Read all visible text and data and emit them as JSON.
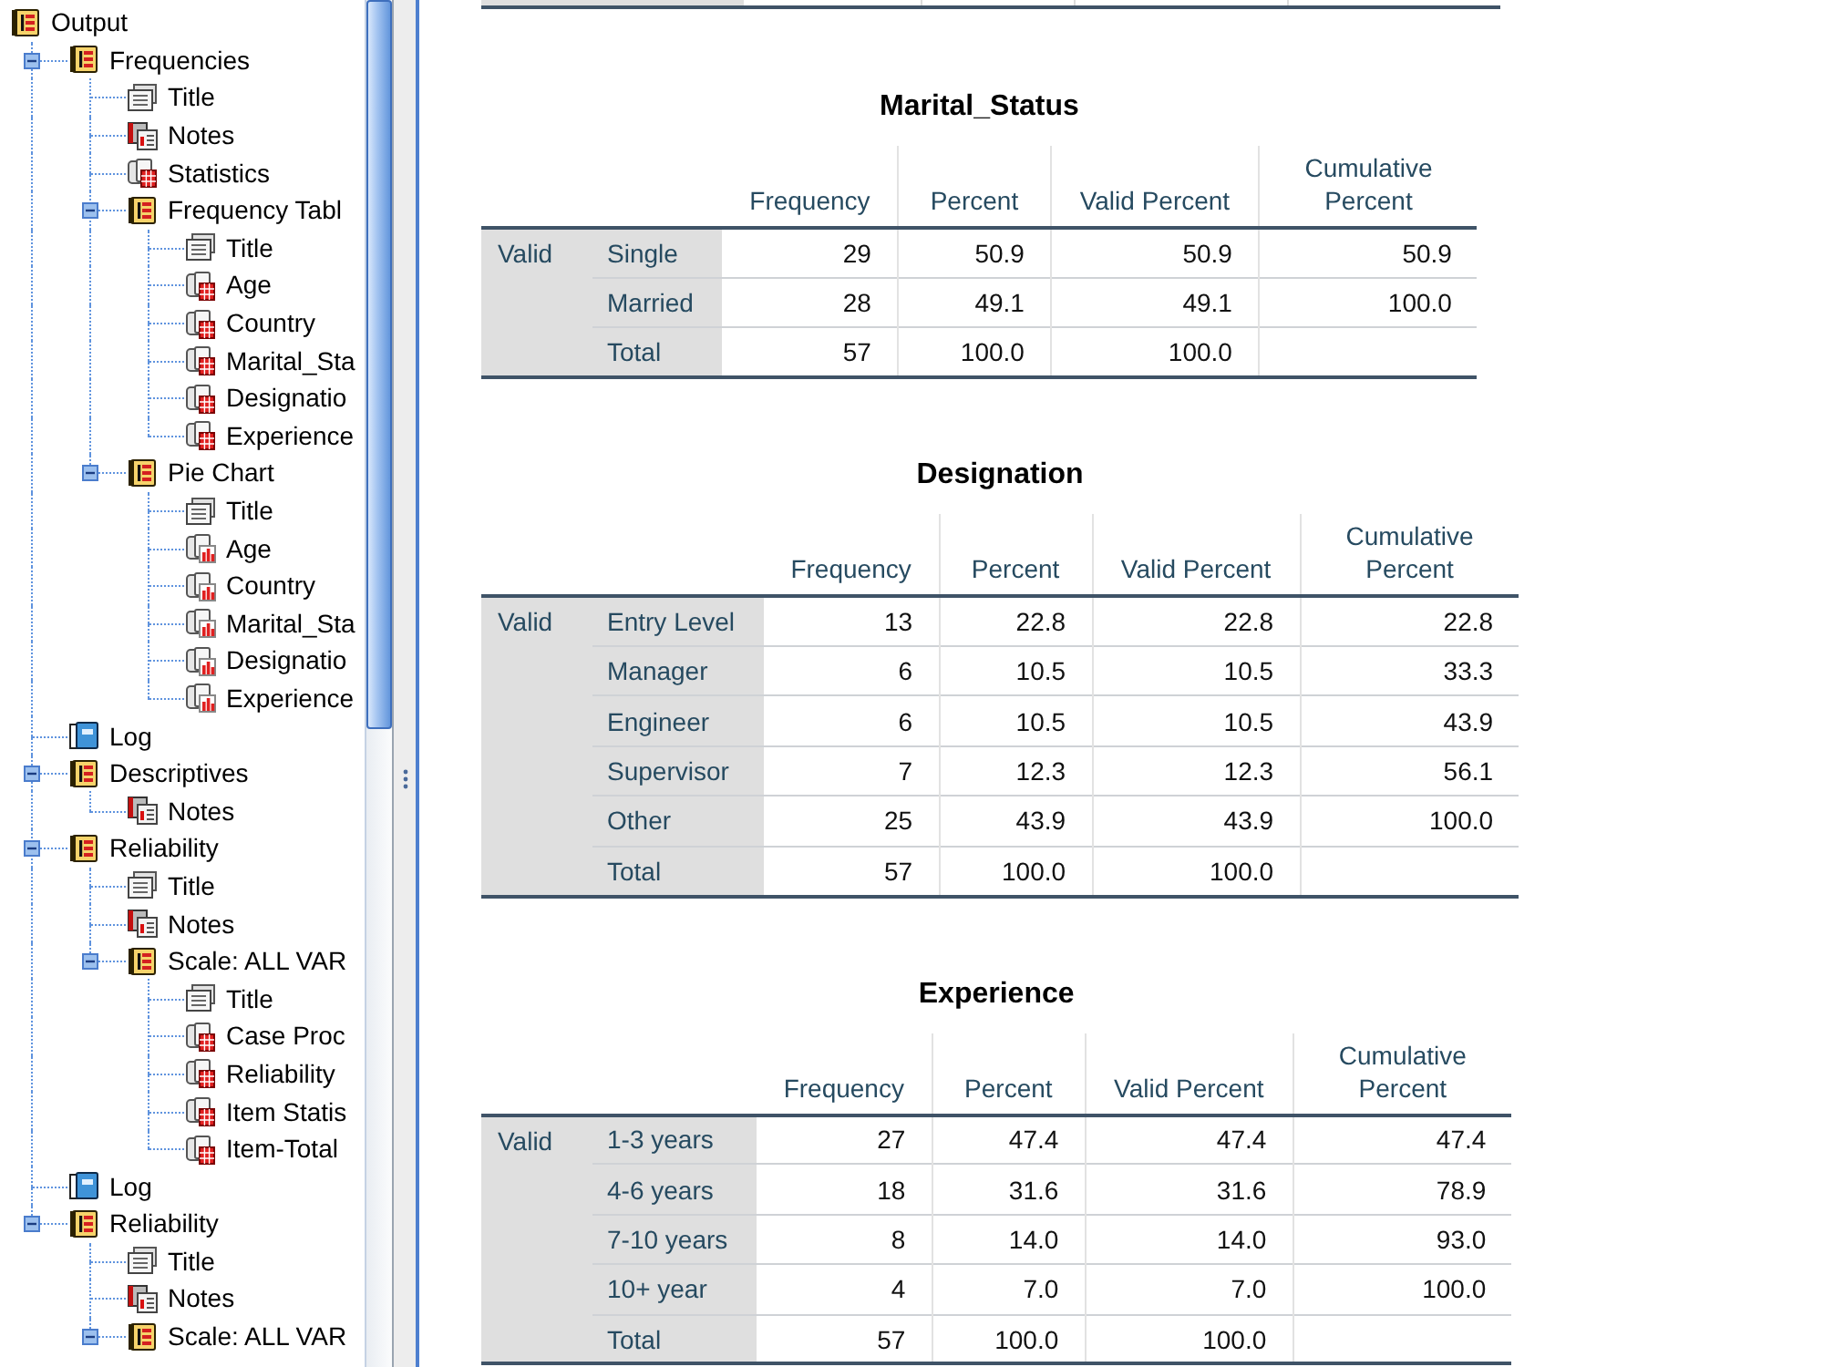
{
  "navigator": {
    "items": [
      {
        "label": "Output",
        "kind": "heading",
        "children": [
          {
            "label": "Frequencies",
            "kind": "heading",
            "expanded": true,
            "children": [
              {
                "label": "Title",
                "kind": "title"
              },
              {
                "label": "Notes",
                "kind": "notes"
              },
              {
                "label": "Statistics",
                "kind": "table"
              },
              {
                "label": "Frequency Tabl",
                "kind": "heading",
                "expanded": true,
                "children": [
                  {
                    "label": "Title",
                    "kind": "title"
                  },
                  {
                    "label": "Age",
                    "kind": "table"
                  },
                  {
                    "label": "Country",
                    "kind": "table"
                  },
                  {
                    "label": "Marital_Sta",
                    "kind": "table"
                  },
                  {
                    "label": "Designatio",
                    "kind": "table"
                  },
                  {
                    "label": "Experience",
                    "kind": "table"
                  }
                ]
              },
              {
                "label": "Pie Chart",
                "kind": "heading",
                "expanded": true,
                "children": [
                  {
                    "label": "Title",
                    "kind": "title"
                  },
                  {
                    "label": "Age",
                    "kind": "chart"
                  },
                  {
                    "label": "Country",
                    "kind": "chart"
                  },
                  {
                    "label": "Marital_Sta",
                    "kind": "chart"
                  },
                  {
                    "label": "Designatio",
                    "kind": "chart"
                  },
                  {
                    "label": "Experience",
                    "kind": "chart"
                  }
                ]
              }
            ]
          },
          {
            "label": "Log",
            "kind": "log"
          },
          {
            "label": "Descriptives",
            "kind": "heading",
            "expanded": true,
            "children": [
              {
                "label": "Notes",
                "kind": "notes"
              }
            ]
          },
          {
            "label": "Reliability",
            "kind": "heading",
            "expanded": true,
            "children": [
              {
                "label": "Title",
                "kind": "title"
              },
              {
                "label": "Notes",
                "kind": "notes"
              },
              {
                "label": "Scale: ALL VAR",
                "kind": "heading",
                "expanded": true,
                "children": [
                  {
                    "label": "Title",
                    "kind": "title"
                  },
                  {
                    "label": "Case Proc",
                    "kind": "table"
                  },
                  {
                    "label": "Reliability",
                    "kind": "table"
                  },
                  {
                    "label": "Item Statis",
                    "kind": "table"
                  },
                  {
                    "label": "Item-Total",
                    "kind": "table"
                  }
                ]
              }
            ]
          },
          {
            "label": "Log",
            "kind": "log"
          },
          {
            "label": "Reliability",
            "kind": "heading",
            "expanded": true,
            "children": [
              {
                "label": "Title",
                "kind": "title"
              },
              {
                "label": "Notes",
                "kind": "notes"
              },
              {
                "label": "Scale: ALL VAR",
                "kind": "heading",
                "expanded": true
              }
            ]
          }
        ]
      }
    ]
  },
  "tables": [
    {
      "title": "Marital_Status",
      "columns": [
        "Frequency",
        "Percent",
        "Valid Percent",
        "Cumulative Percent"
      ],
      "group": "Valid",
      "rows": [
        {
          "label": "Single",
          "values": [
            "29",
            "50.9",
            "50.9",
            "50.9"
          ]
        },
        {
          "label": "Married",
          "values": [
            "28",
            "49.1",
            "49.1",
            "100.0"
          ]
        },
        {
          "label": "Total",
          "values": [
            "57",
            "100.0",
            "100.0"
          ]
        }
      ]
    },
    {
      "title": "Designation",
      "columns": [
        "Frequency",
        "Percent",
        "Valid Percent",
        "Cumulative Percent"
      ],
      "group": "Valid",
      "rows": [
        {
          "label": "Entry Level",
          "values": [
            "13",
            "22.8",
            "22.8",
            "22.8"
          ]
        },
        {
          "label": "Manager",
          "values": [
            "6",
            "10.5",
            "10.5",
            "33.3"
          ]
        },
        {
          "label": "Engineer",
          "values": [
            "6",
            "10.5",
            "10.5",
            "43.9"
          ]
        },
        {
          "label": "Supervisor",
          "values": [
            "7",
            "12.3",
            "12.3",
            "56.1"
          ]
        },
        {
          "label": "Other",
          "values": [
            "25",
            "43.9",
            "43.9",
            "100.0"
          ]
        },
        {
          "label": "Total",
          "values": [
            "57",
            "100.0",
            "100.0"
          ]
        }
      ]
    },
    {
      "title": "Experience",
      "columns": [
        "Frequency",
        "Percent",
        "Valid Percent",
        "Cumulative Percent"
      ],
      "group": "Valid",
      "rows": [
        {
          "label": "1-3 years",
          "values": [
            "27",
            "47.4",
            "47.4",
            "47.4"
          ]
        },
        {
          "label": "4-6 years",
          "values": [
            "18",
            "31.6",
            "31.6",
            "78.9"
          ]
        },
        {
          "label": "7-10 years",
          "values": [
            "8",
            "14.0",
            "14.0",
            "93.0"
          ]
        },
        {
          "label": "10+ year",
          "values": [
            "4",
            "7.0",
            "7.0",
            "100.0"
          ]
        },
        {
          "label": "Total",
          "values": [
            "57",
            "100.0",
            "100.0"
          ]
        }
      ]
    }
  ]
}
